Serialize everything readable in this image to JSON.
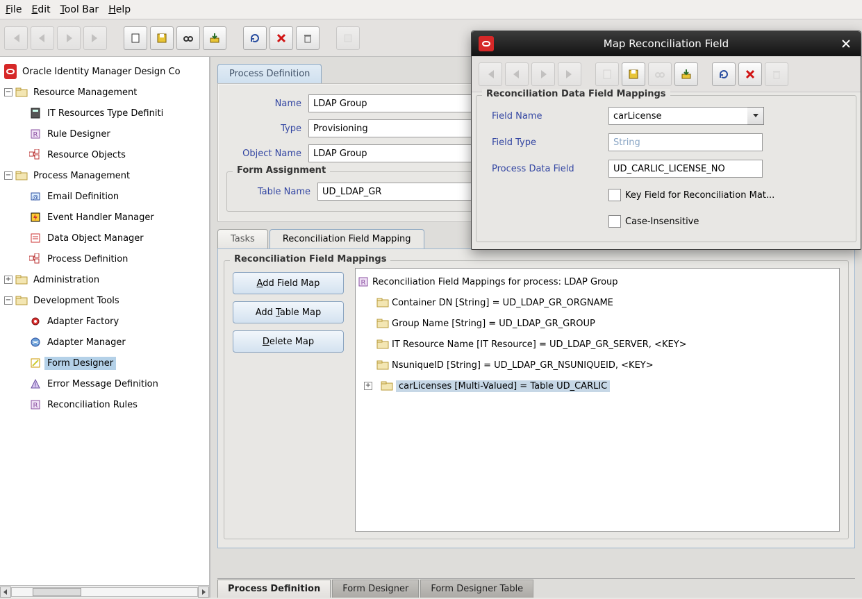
{
  "menu": {
    "file": "File",
    "edit": "Edit",
    "toolbar": "Tool Bar",
    "help": "Help"
  },
  "tree": {
    "root": "Oracle Identity Manager Design Co",
    "resource_mgmt": "Resource Management",
    "it_resources_type": "IT Resources Type Definiti",
    "rule_designer": "Rule Designer",
    "resource_objects": "Resource Objects",
    "process_mgmt": "Process Management",
    "email_def": "Email Definition",
    "event_handler": "Event Handler Manager",
    "data_object_mgr": "Data Object Manager",
    "process_def": "Process Definition",
    "administration": "Administration",
    "dev_tools": "Development Tools",
    "adapter_factory": "Adapter Factory",
    "adapter_manager": "Adapter Manager",
    "form_designer": "Form Designer",
    "error_msg_def": "Error Message Definition",
    "recon_rules": "Reconciliation Rules"
  },
  "top_tab": "Process Definition",
  "process": {
    "name_label": "Name",
    "name_value": "LDAP Group",
    "type_label": "Type",
    "type_value": "Provisioning",
    "obj_label": "Object Name",
    "obj_value": "LDAP Group"
  },
  "form_assign": {
    "legend": "Form Assignment",
    "table_label": "Table Name",
    "table_value": "UD_LDAP_GR"
  },
  "mid_tabs": {
    "tasks": "Tasks",
    "recon": "Reconciliation Field Mapping"
  },
  "recon_legend": "Reconciliation Field Mappings",
  "buttons": {
    "add_field": "Add Field Map",
    "add_table": "Add Table Map",
    "delete_map": "Delete Map"
  },
  "recon_tree": {
    "root": "Reconciliation Field Mappings for process: LDAP Group",
    "n1": "Container DN [String] = UD_LDAP_GR_ORGNAME",
    "n2": "Group Name [String] = UD_LDAP_GR_GROUP",
    "n3": "IT Resource Name [IT Resource] = UD_LDAP_GR_SERVER, <KEY>",
    "n4": "NsuniqueID [String] = UD_LDAP_GR_NSUNIQUEID, <KEY>",
    "n5": "carLicenses [Multi-Valued] = Table UD_CARLIC"
  },
  "bottom_tabs": {
    "pd": "Process Definition",
    "fd": "Form Designer",
    "fdt": "Form Designer Table"
  },
  "dialog": {
    "title": "Map Reconciliation Field",
    "legend": "Reconciliation Data Field Mappings",
    "field_name_label": "Field Name",
    "field_name_value": "carLicense",
    "field_type_label": "Field Type",
    "field_type_value": "String",
    "pdf_label": "Process Data Field",
    "pdf_value": "UD_CARLIC_LICENSE_NO",
    "key_field_label": "Key Field for Reconciliation Mat...",
    "case_insensitive_label": "Case-Insensitive"
  }
}
